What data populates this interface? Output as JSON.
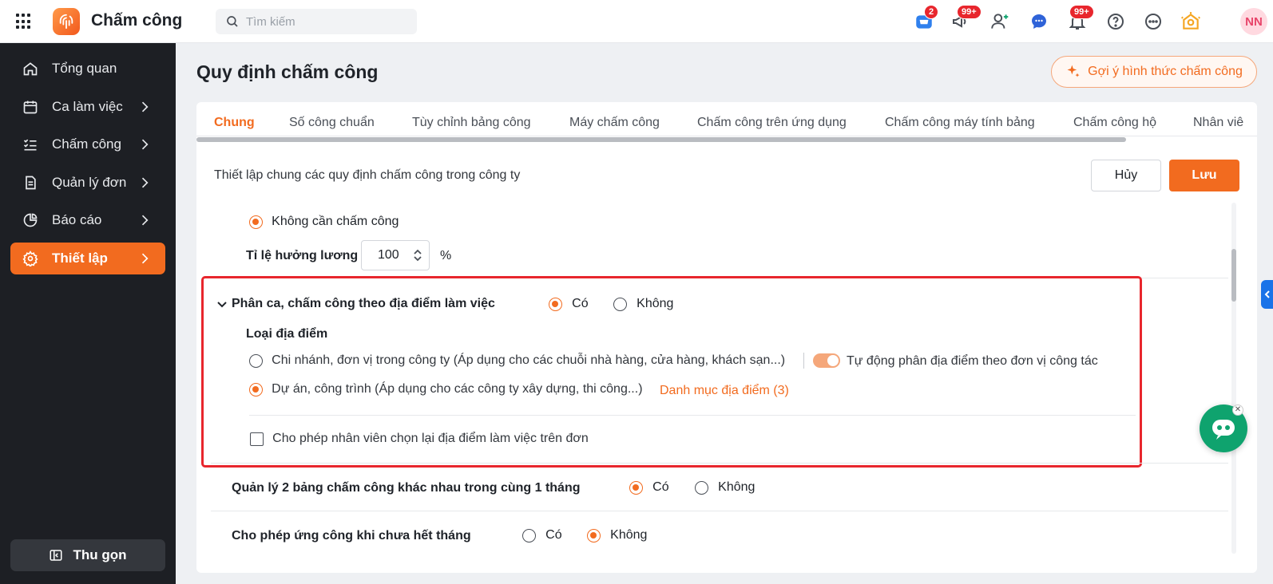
{
  "app": {
    "title": "Chấm công"
  },
  "search": {
    "placeholder": "Tìm kiếm"
  },
  "topbar": {
    "cart_badge": "2",
    "announce_badge": "99+",
    "notify_badge": "99+",
    "avatar": "NN"
  },
  "sidebar": {
    "items": [
      {
        "label": "Tổng quan",
        "icon": "home-icon"
      },
      {
        "label": "Ca làm việc",
        "icon": "calendar-icon"
      },
      {
        "label": "Chấm công",
        "icon": "checklist-icon"
      },
      {
        "label": "Quản lý đơn",
        "icon": "document-icon"
      },
      {
        "label": "Báo cáo",
        "icon": "pie-chart-icon"
      },
      {
        "label": "Thiết lập",
        "icon": "gear-icon"
      }
    ],
    "collapse_label": "Thu gọn"
  },
  "page": {
    "title": "Quy định chấm công",
    "suggest_label": "Gợi ý hình thức chấm công"
  },
  "tabs": [
    "Chung",
    "Số công chuẩn",
    "Tùy chỉnh bảng công",
    "Máy chấm công",
    "Chấm công trên ứng dụng",
    "Chấm công máy tính bảng",
    "Chấm công hộ",
    "Nhân viê"
  ],
  "content": {
    "description": "Thiết lập chung các quy định chấm công trong công ty",
    "cancel_label": "Hủy",
    "save_label": "Lưu",
    "no_attendance_label": "Không cần chấm công",
    "salary_ratio_label": "Tỉ lệ hưởng lương",
    "salary_ratio_value": "100",
    "percent_sign": "%",
    "location_section": {
      "title": "Phân ca, chấm công theo địa điểm làm việc",
      "yes": "Có",
      "no": "Không",
      "selected": "Có",
      "type_label": "Loại địa điểm",
      "option_branch": "Chi nhánh, đơn vị trong công ty (Áp dụng cho các chuỗi nhà hàng, cửa hàng, khách sạn...)",
      "auto_assign_label": "Tự động phân địa điểm theo đơn vị công tác",
      "option_project": "Dự án, công trình (Áp dụng cho các công ty xây dựng, thi công...)",
      "location_catalog_link": "Danh mục địa điểm (3)",
      "allow_reselect_label": "Cho phép nhân viên chọn lại địa điểm làm việc trên đơn"
    },
    "two_sheets": {
      "label": "Quản lý 2 bảng chấm công khác nhau trong cùng 1 tháng",
      "yes": "Có",
      "no": "Không",
      "selected": "Có"
    },
    "advance": {
      "label": "Cho phép ứng công khi chưa hết tháng",
      "yes": "Có",
      "no": "Không",
      "selected": "Không"
    }
  },
  "colors": {
    "accent": "#f26b1f",
    "highlight": "#e8262d",
    "sidebar_bg": "#1d1f24"
  }
}
